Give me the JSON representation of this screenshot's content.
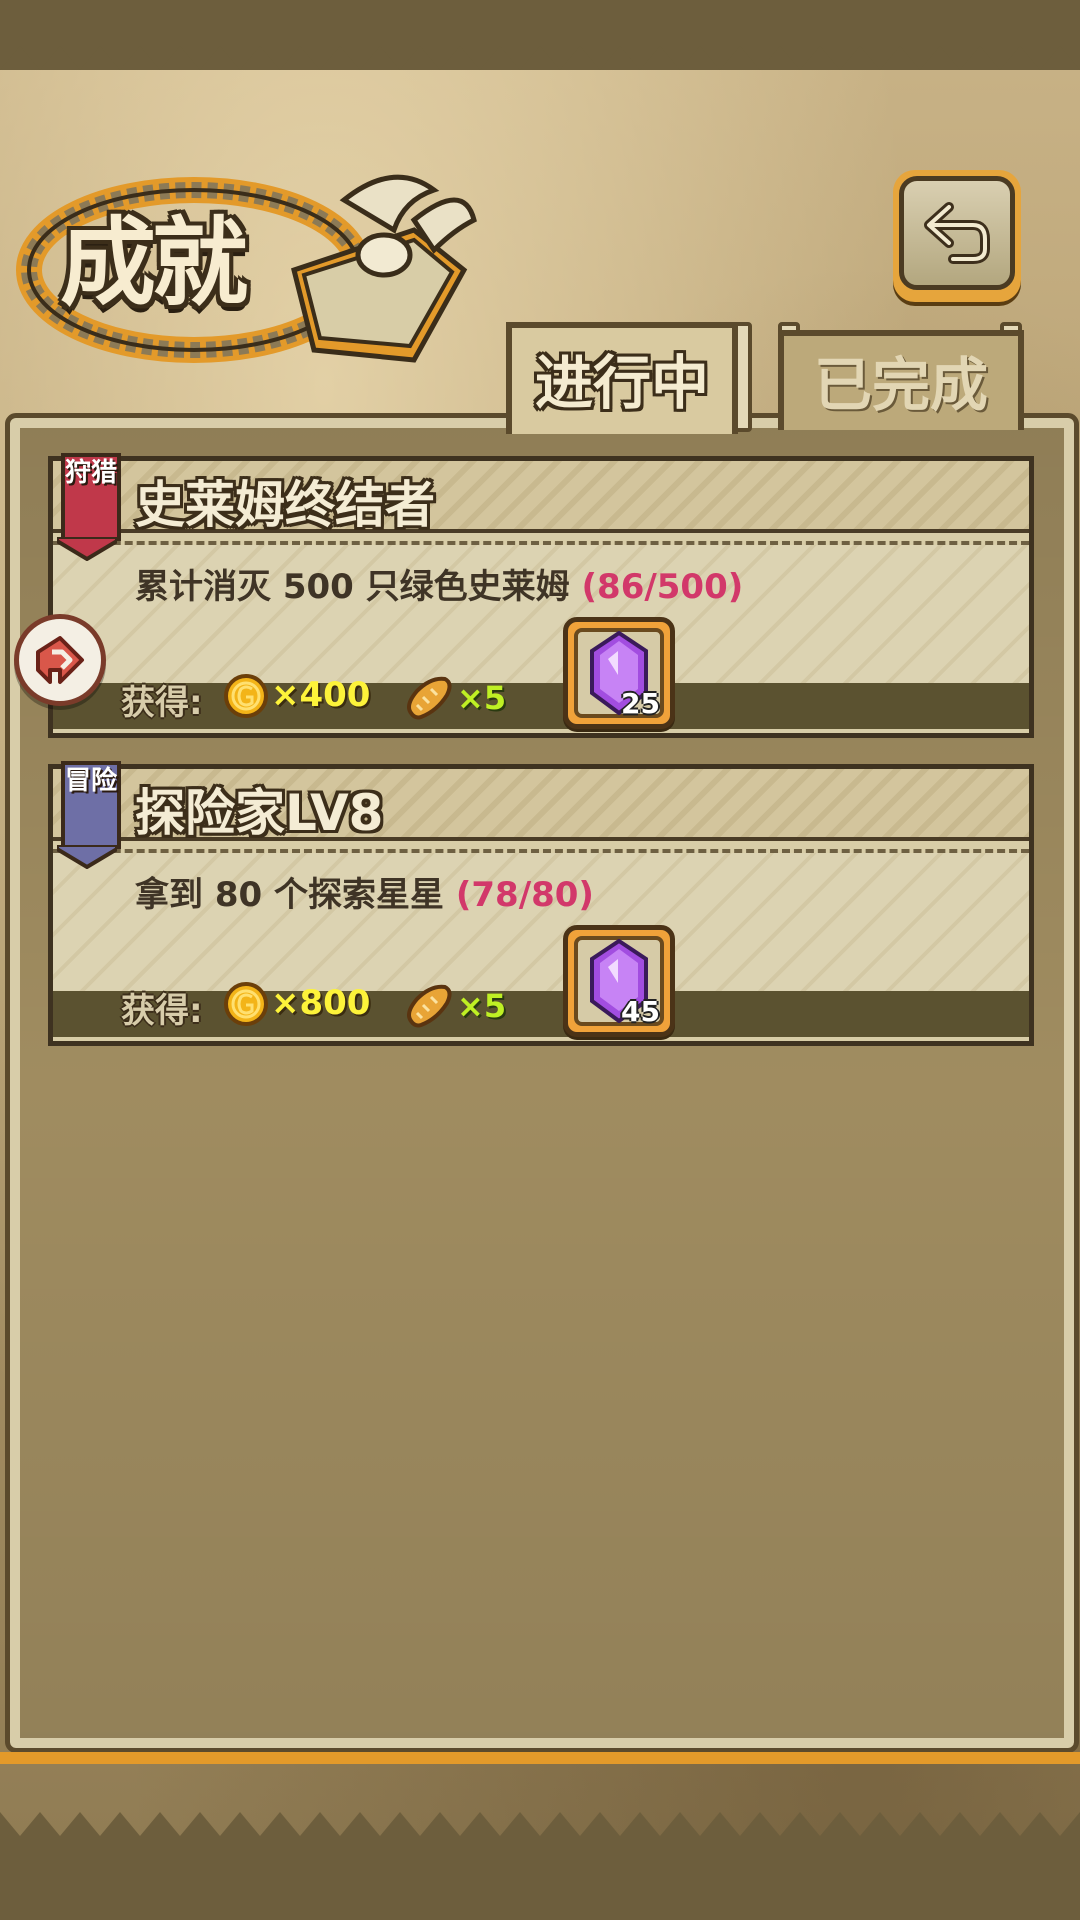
{
  "screen": {
    "title": "成就",
    "back_icon": "return-arrow-icon"
  },
  "tabs": [
    {
      "label": "进行中",
      "active": true
    },
    {
      "label": "已完成",
      "active": false
    }
  ],
  "achievements": [
    {
      "category": "狩猎",
      "category_color": "#c0384a",
      "title": "史莱姆终结者",
      "description": "累计消灭 500 只绿色史莱姆",
      "progress": "(86/500)",
      "reward_label": "获得:",
      "coins": "×400",
      "bread": "×5",
      "gems": "25"
    },
    {
      "category": "冒险",
      "category_color": "#6e6fa6",
      "title": "探险家LV8",
      "description": "拿到 80 个探索星星",
      "progress": "(78/80)",
      "reward_label": "获得:",
      "coins": "×800",
      "bread": "×5",
      "gems": "45"
    }
  ],
  "colors": {
    "progress": "#d2386a",
    "coin_text": "#fdf33a",
    "bread_text": "#bff024",
    "frame_orange": "#e39a2a"
  }
}
